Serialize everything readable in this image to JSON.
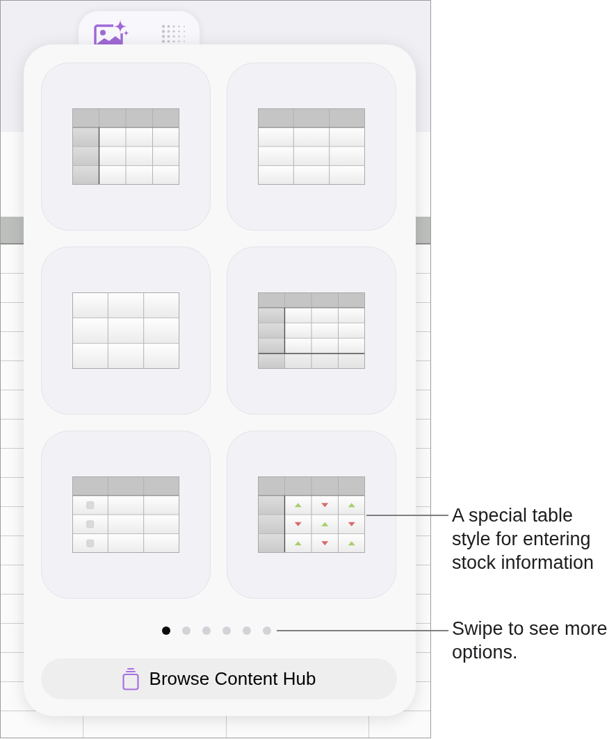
{
  "tabs": [
    {
      "kind": "image",
      "selected": true
    },
    {
      "kind": "pattern",
      "selected": false
    }
  ],
  "table_styles": [
    {
      "kind": "header_row_column"
    },
    {
      "kind": "header_row"
    },
    {
      "kind": "plain"
    },
    {
      "kind": "header_row_column_footer"
    },
    {
      "kind": "checklist"
    },
    {
      "kind": "stock"
    }
  ],
  "page_dots": [
    {
      "selected": true
    },
    {
      "selected": false
    },
    {
      "selected": false
    },
    {
      "selected": false
    },
    {
      "selected": false
    },
    {
      "selected": false
    }
  ],
  "browse_button": {
    "label": "Browse Content Hub"
  },
  "callouts": [
    {
      "text": "A special table style for entering stock information"
    },
    {
      "text": "Swipe to see more options."
    }
  ]
}
